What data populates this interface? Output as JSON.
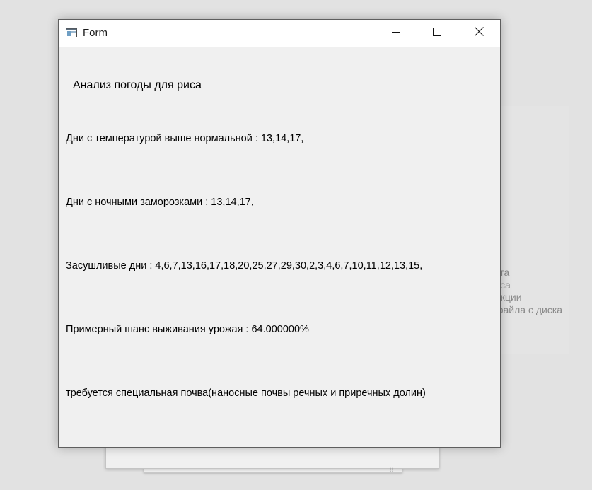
{
  "window": {
    "title": "Form",
    "icon": "window-app-icon",
    "controls": [
      "minimize-icon",
      "maximize-icon",
      "close-icon"
    ]
  },
  "content": {
    "heading": "Анализ погоды для риса",
    "hot_days": "Дни с температурой выше нормальной : 13,14,17,",
    "frost_nights": "Дни с ночными заморозками : 13,14,17,",
    "dry_days": "Засушливые дни : 4,6,7,13,16,17,18,20,25,27,29,30,2,3,4,6,7,10,11,12,13,15,",
    "survival_chance": "Примерный шанс выживания урожая : 64.000000%",
    "soil_note": "требуется специальная почва(наносные почвы речных и приречных долин)"
  },
  "background": {
    "menu_fragments": [
      "кта",
      "сса",
      "нкции",
      "файла с диска"
    ]
  }
}
